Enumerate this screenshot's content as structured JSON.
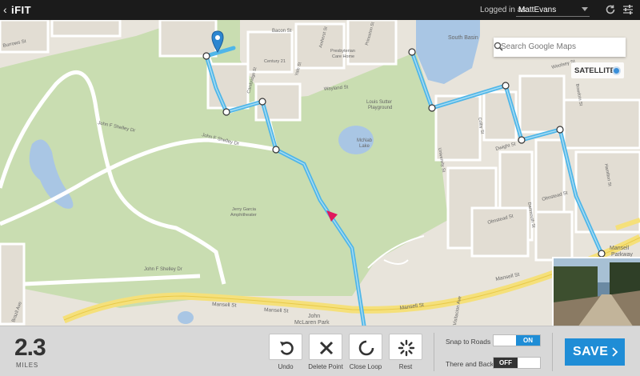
{
  "app": {
    "back_glyph": "‹",
    "logo": "iFIT",
    "logged_in_label": "Logged in as:",
    "username": "MattEvans"
  },
  "map": {
    "search_placeholder": "Search Google Maps",
    "satellite_label": "SATELLITE",
    "labels": {
      "south_basin": "South Basin",
      "presbyterian": "Presbyterian",
      "care_home": "Care Home",
      "century21": "Century 21",
      "bacon_st": "Bacon St",
      "burrows_st": "Burrows St",
      "wayland_st": "Wayland St",
      "woolsey_st": "Woolsey St",
      "dwight_st": "Dwight St",
      "olmstead_st": "Olmstead St",
      "mansell_st": "Mansell St",
      "jf_shelley": "John F Shelley Dr",
      "louis_sutter": "Louis Sutter",
      "playground": "Playground",
      "mcnab": "McNab",
      "lake": "Lake",
      "jerry_garcia": "Jerry Garcia",
      "amphitheater": "Amphitheater",
      "john": "John",
      "mclaren_park": "McLaren Park",
      "vistacion": "Visitacion Ave",
      "brazil": "Brazil Ave",
      "mansell_parkway": "Mansell",
      "parkway": "Parkway",
      "cambridge": "Cambridge St",
      "yale": "Yale St",
      "amherst": "Amherst St",
      "princeton": "Princeton St",
      "university": "University St",
      "colby": "Colby St",
      "dartmouth": "Dartmouth St",
      "bowdoin": "Bowdoin St",
      "hamilton": "Hamilton St"
    },
    "route_color": "#4fb6e8",
    "park_color": "#c8ddb0"
  },
  "stats": {
    "distance": "2.3",
    "unit": "MILES"
  },
  "tools": [
    {
      "label": "Undo"
    },
    {
      "label": "Delete Point"
    },
    {
      "label": "Close Loop"
    },
    {
      "label": "Rest"
    }
  ],
  "options": {
    "snap_label": "Snap to Roads",
    "snap_value": "ON",
    "there_back_label": "There and Back",
    "there_back_value": "OFF"
  },
  "save_label": "SAVE"
}
